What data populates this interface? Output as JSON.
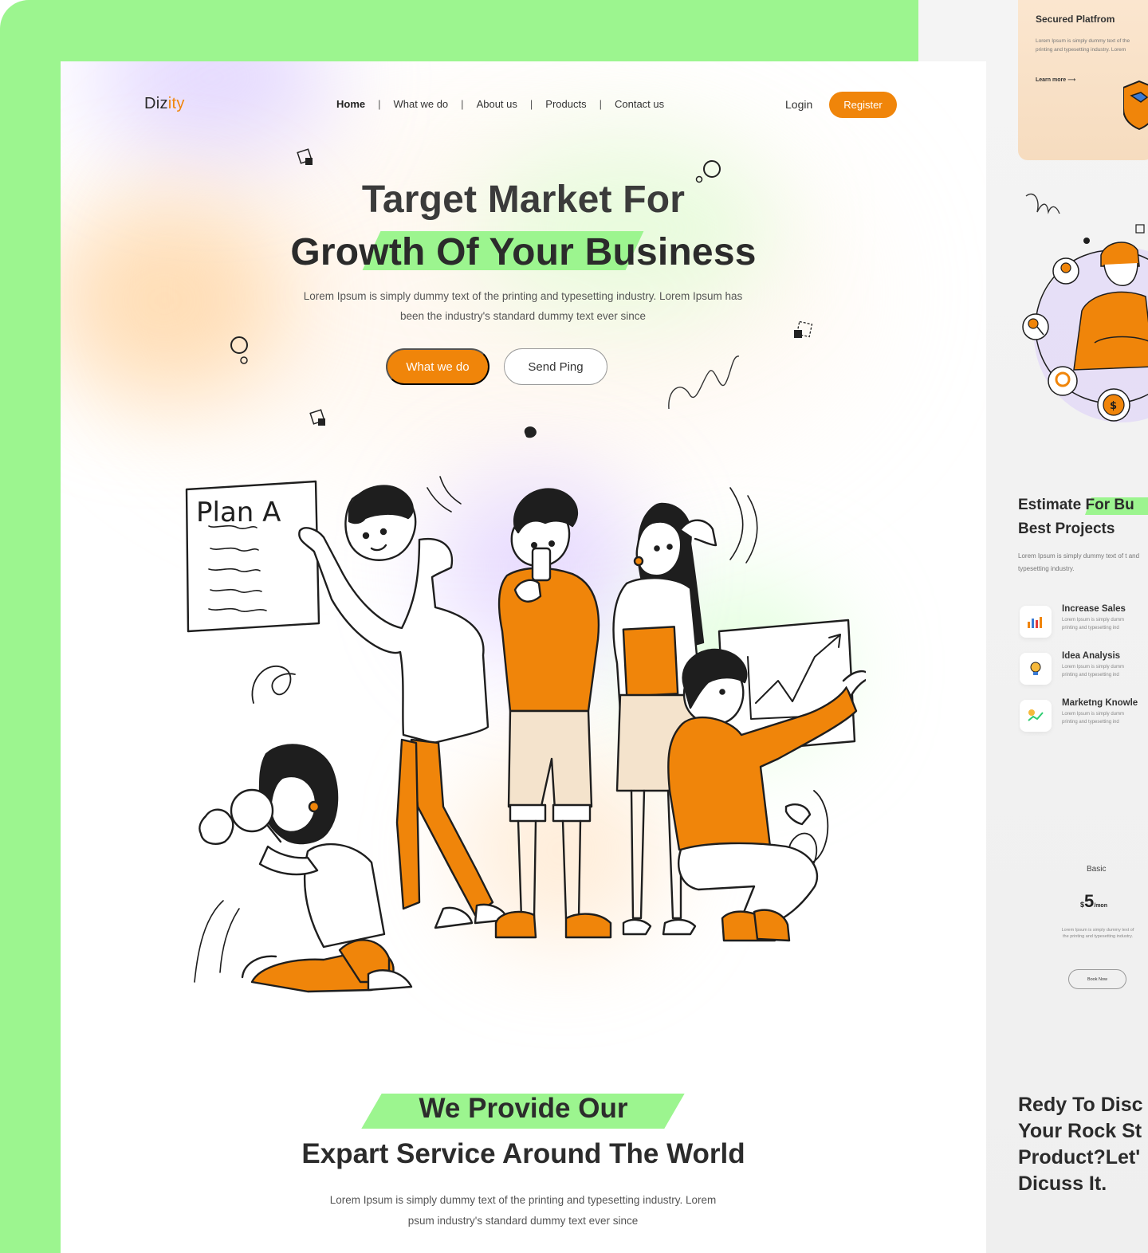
{
  "brand": {
    "name_part1": "Diz",
    "name_part2": "ity",
    "accent": "#f0850a"
  },
  "nav": {
    "items": [
      "Home",
      "What we do",
      "About us",
      "Products",
      "Contact us"
    ],
    "active": "Home",
    "separator": "|"
  },
  "auth": {
    "login_label": "Login",
    "register_label": "Register"
  },
  "hero": {
    "title_line1": "Target Market For",
    "title_line2": "Growth Of Your Business",
    "subtitle_line1": "Lorem Ipsum is simply dummy text of the printing and typesetting industry. Lorem Ipsum has",
    "subtitle_line2": "been the  industry's standard dummy text ever since",
    "primary_button": "What we do",
    "secondary_button": "Send Ping"
  },
  "illustration": {
    "whiteboard_text": "Plan A"
  },
  "section2": {
    "title_line1": "We Provide Our",
    "title_line2": "Expart Service Around The World",
    "subtitle_line1": "Lorem Ipsum is simply dummy text of the printing and typesetting industry. Lorem",
    "subtitle_line2": "psum industry's standard dummy text ever since"
  },
  "side_preview": {
    "secure_card": {
      "title": "Secured Platfrom",
      "desc": "Lorem Ipsum is simply dummy text of the printing and typesetting industry. Lorem",
      "link": "Learn more"
    },
    "estimate_title_line1": "Estimate For Bu",
    "estimate_title_line2": "Best Projects",
    "estimate_desc": "Lorem Ipsum is simply dummy text of t and typesetting industry.",
    "features": [
      {
        "title": "Increase Sales",
        "desc_line1": "Lorem Ipsum is simply dumm",
        "desc_line2": "printing and typesetting ind",
        "icon": "bar-chart-icon"
      },
      {
        "title": "Idea Analysis",
        "desc_line1": "Lorem Ipsum is simply dumm",
        "desc_line2": "printing and typesetting ind",
        "icon": "lightbulb-icon"
      },
      {
        "title": "Marketng Knowle",
        "desc_line1": "Lorem Ipsum is simply dumm",
        "desc_line2": "printing and typesetting ind",
        "icon": "growth-icon"
      }
    ],
    "pricing": {
      "plan": "Basic",
      "currency": "$",
      "amount": "5",
      "period": "/mon",
      "desc": "Lorem Ipsum is simply dummy text of the printing and typesetting industry.",
      "button": "Book Now"
    },
    "cta_lines": [
      "Redy To Disc",
      "Your Rock St",
      "Product?Let'",
      "Dicuss It."
    ]
  },
  "colors": {
    "green": "#9cf58f",
    "orange": "#f0850a",
    "text_dark": "#2b2b2b"
  }
}
